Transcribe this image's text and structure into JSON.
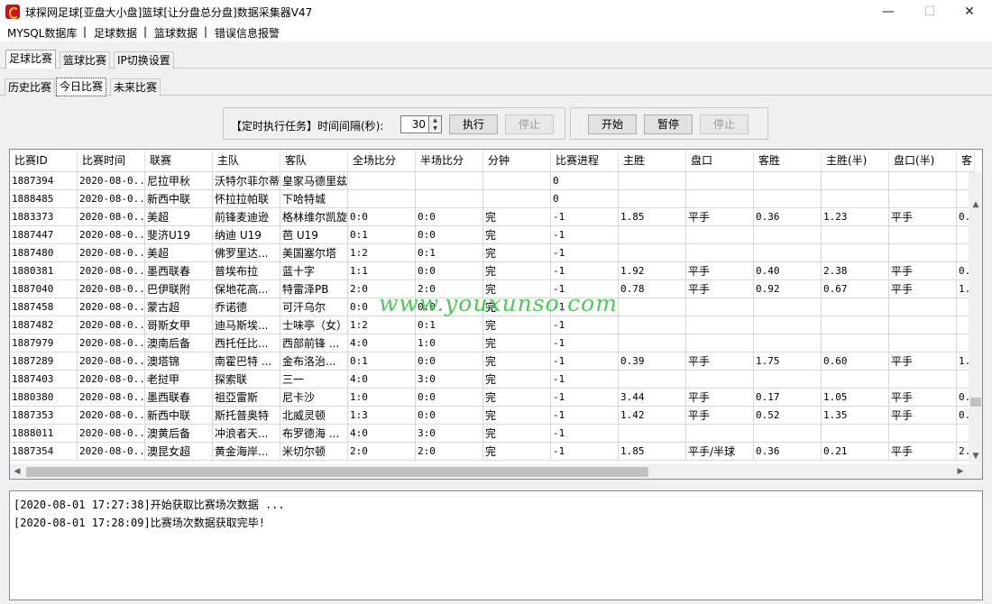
{
  "window": {
    "title": "球探网足球[亚盘大小盘]篮球[让分盘总分盘]数据采集器V47",
    "minimize": "—",
    "maximize": "☐",
    "close": "✕"
  },
  "menu": [
    "MYSQL数据库",
    "足球数据",
    "篮球数据",
    "错误信息报警"
  ],
  "menu_separator": "|",
  "main_tabs": [
    "足球比赛",
    "篮球比赛",
    "IP切换设置"
  ],
  "sub_tabs": [
    "历史比赛",
    "今日比赛",
    "未来比赛"
  ],
  "scheduler": {
    "label": "【定时执行任务】时间间隔(秒):",
    "interval": "30",
    "execute": "执行",
    "stop": "停止"
  },
  "controls": {
    "start": "开始",
    "pause": "暂停",
    "stop": "停止"
  },
  "grid": {
    "columns": [
      "比赛ID",
      "比赛时间",
      "联赛",
      "主队",
      "客队",
      "全场比分",
      "半场比分",
      "分钟",
      "比赛进程",
      "主胜",
      "盘口",
      "客胜",
      "主胜(半)",
      "盘口(半)",
      "客"
    ],
    "rows": [
      [
        "1887394",
        "2020-08-0...",
        "尼拉甲秋",
        "沃特尔菲尔蒂",
        "皇家马德里兹",
        "",
        "",
        "",
        "0",
        "",
        "",
        "",
        "",
        "",
        ""
      ],
      [
        "1888485",
        "2020-08-0...",
        "新西中联",
        "怀拉拉帕联",
        "下哈特城",
        "",
        "",
        "",
        "0",
        "",
        "",
        "",
        "",
        "",
        ""
      ],
      [
        "1883373",
        "2020-08-0...",
        "美超",
        "前锋麦迪逊",
        "格林维尔凯旋",
        "0:0",
        "0:0",
        "完",
        "-1",
        "1.85",
        "平手",
        "0.36",
        "1.23",
        "平手",
        "0."
      ],
      [
        "1887447",
        "2020-08-0...",
        "斐济U19",
        "纳迪 U19",
        "芭 U19",
        "0:1",
        "0:0",
        "完",
        "-1",
        "",
        "",
        "",
        "",
        "",
        ""
      ],
      [
        "1887480",
        "2020-08-0...",
        "美超",
        "佛罗里达...",
        "美国塞尔塔",
        "1:2",
        "0:1",
        "完",
        "-1",
        "",
        "",
        "",
        "",
        "",
        ""
      ],
      [
        "1880381",
        "2020-08-0...",
        "墨西联春",
        "普埃布拉",
        "蓝十字",
        "1:1",
        "0:0",
        "完",
        "-1",
        "1.92",
        "平手",
        "0.40",
        "2.38",
        "平手",
        "0."
      ],
      [
        "1887040",
        "2020-08-0...",
        "巴伊联附",
        "保地花高...",
        "特雷泽PB",
        "2:0",
        "2:0",
        "完",
        "-1",
        "0.78",
        "平手",
        "0.92",
        "0.67",
        "平手",
        "1."
      ],
      [
        "1887458",
        "2020-08-0...",
        "蒙古超",
        "乔诺德",
        "可汗乌尔",
        "0:0",
        "0:0",
        "完",
        "-1",
        "",
        "",
        "",
        "",
        "",
        ""
      ],
      [
        "1887482",
        "2020-08-0...",
        "哥斯女甲",
        "迪马斯埃...",
        "士味亭（女）",
        "1:2",
        "0:1",
        "完",
        "-1",
        "",
        "",
        "",
        "",
        "",
        ""
      ],
      [
        "1887979",
        "2020-08-0...",
        "澳南后备",
        "西托任比...",
        "西部前锋 ...",
        "4:0",
        "1:0",
        "完",
        "-1",
        "",
        "",
        "",
        "",
        "",
        ""
      ],
      [
        "1887289",
        "2020-08-0...",
        "澳塔锦",
        "南霍巴特 ...",
        "金布洛治...",
        "0:1",
        "0:0",
        "完",
        "-1",
        "0.39",
        "平手",
        "1.75",
        "0.60",
        "平手",
        "1."
      ],
      [
        "1887403",
        "2020-08-0...",
        "老挝甲",
        "探索联",
        "三一",
        "4:0",
        "3:0",
        "完",
        "-1",
        "",
        "",
        "",
        "",
        "",
        ""
      ],
      [
        "1880380",
        "2020-08-0...",
        "墨西联春",
        "祖亞雷斯",
        "尼卡沙",
        "1:0",
        "0:0",
        "完",
        "-1",
        "3.44",
        "平手",
        "0.17",
        "1.05",
        "平手",
        "0."
      ],
      [
        "1887353",
        "2020-08-0...",
        "新西中联",
        "斯托普奥特",
        "北威灵顿",
        "1:3",
        "0:0",
        "完",
        "-1",
        "1.42",
        "平手",
        "0.52",
        "1.35",
        "平手",
        "0."
      ],
      [
        "1888011",
        "2020-08-0...",
        "澳黄后备",
        "冲浪者天...",
        "布罗德海 ...",
        "4:0",
        "3:0",
        "完",
        "-1",
        "",
        "",
        "",
        "",
        "",
        ""
      ],
      [
        "1887354",
        "2020-08-0...",
        "澳昆女超",
        "黄金海岸...",
        "米切尔顿",
        "2:0",
        "2:0",
        "完",
        "-1",
        "1.85",
        "平手/半球",
        "0.36",
        "0.21",
        "平手",
        "2."
      ]
    ]
  },
  "watermark": "www.youxunso.com",
  "log": [
    "[2020-08-01 17:27:38]开始获取比赛场次数据 ...",
    "[2020-08-01 17:28:09]比赛场次数据获取完毕!"
  ],
  "icons": {
    "app": "football-logo-icon",
    "spin_up": "▲",
    "spin_down": "▼",
    "up": "▲",
    "down": "▼",
    "left": "◀",
    "right": "▶"
  }
}
